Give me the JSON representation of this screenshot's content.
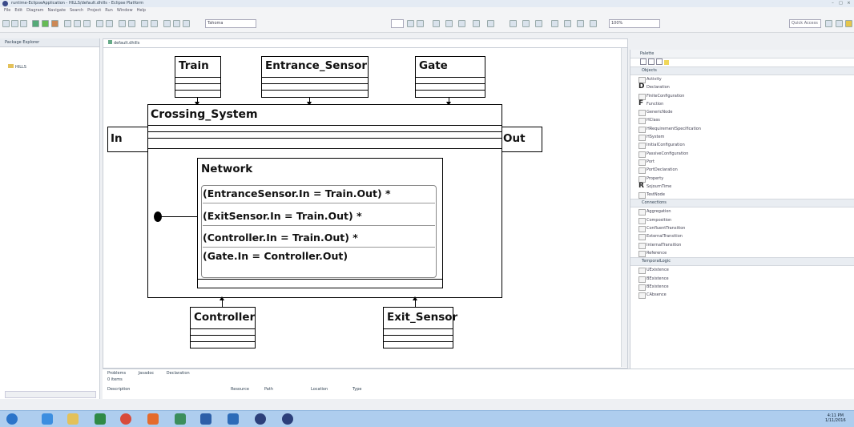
{
  "window": {
    "title": "runtime-EclipseApplication - HILLS/default.dhills - Eclipse Platform"
  },
  "menu": [
    "File",
    "Edit",
    "Diagram",
    "Navigate",
    "Search",
    "Project",
    "Run",
    "Window",
    "Help"
  ],
  "toolbar": {
    "font": "Tahoma",
    "zoom": "100%",
    "quick_access": "Quick Access"
  },
  "package_explorer": {
    "tab": "Package Explorer",
    "items": [
      "HILLS"
    ]
  },
  "editor": {
    "tab": "default.dhills"
  },
  "diagram": {
    "train": "Train",
    "entrance_sensor": "Entrance_Sensor",
    "gate": "Gate",
    "system": "Crossing_System",
    "in_port": "In",
    "out_port": "Out",
    "network": "Network",
    "statements": [
      "(EntranceSensor.In = Train.Out) *",
      "(ExitSensor.In = Train.Out) *",
      "(Controller.In = Train.Out) *",
      "(Gate.In = Controller.Out)"
    ],
    "controller": "Controller",
    "exit_sensor": "Exit_Sensor"
  },
  "palette": {
    "title": "Palette",
    "sections": [
      {
        "name": "Objects",
        "items": [
          {
            "label": "Activity",
            "icon": "box-icon"
          },
          {
            "label": "Declaration",
            "icon": "D"
          },
          {
            "label": "FiniteConfiguration",
            "icon": "box-icon"
          },
          {
            "label": "Function",
            "icon": "F"
          },
          {
            "label": "GenericNode",
            "icon": "box-icon"
          },
          {
            "label": "HClass",
            "icon": "box-icon"
          },
          {
            "label": "HRequirementSpecification",
            "icon": "box-icon"
          },
          {
            "label": "HSystem",
            "icon": "box-icon"
          },
          {
            "label": "InitialConfiguration",
            "icon": "box-icon"
          },
          {
            "label": "PassiveConfiguration",
            "icon": "box-icon"
          },
          {
            "label": "Port",
            "icon": "box-icon"
          },
          {
            "label": "PortDeclaration",
            "icon": "box-icon"
          },
          {
            "label": "Property",
            "icon": "box-icon"
          },
          {
            "label": "SojournTime",
            "icon": "R"
          },
          {
            "label": "TestNode",
            "icon": "box-icon"
          }
        ]
      },
      {
        "name": "Connections",
        "items": [
          {
            "label": "Aggregation",
            "icon": "box-icon"
          },
          {
            "label": "Composition",
            "icon": "box-icon"
          },
          {
            "label": "ConfluentTransition",
            "icon": "box-icon"
          },
          {
            "label": "ExternalTransition",
            "icon": "box-icon"
          },
          {
            "label": "InternalTransition",
            "icon": "box-icon"
          },
          {
            "label": "Reference",
            "icon": "box-icon"
          }
        ]
      },
      {
        "name": "TemporalLogic",
        "items": [
          {
            "label": "UExistence",
            "icon": "box-icon"
          },
          {
            "label": "BExistence",
            "icon": "box-icon"
          },
          {
            "label": "BExistence",
            "icon": "box-icon"
          },
          {
            "label": "CAbsence",
            "icon": "box-icon"
          }
        ]
      }
    ]
  },
  "problems": {
    "tabs": [
      "Problems",
      "Javadoc",
      "Declaration"
    ],
    "count": "0 items",
    "columns": [
      "Description",
      "Resource",
      "Path",
      "Location",
      "Type"
    ]
  },
  "taskbar": {
    "time": "4:11 PM",
    "date": "1/11/2016"
  },
  "colors": {
    "taskbar": "#aecdee",
    "chrome": "#eef0f3"
  }
}
